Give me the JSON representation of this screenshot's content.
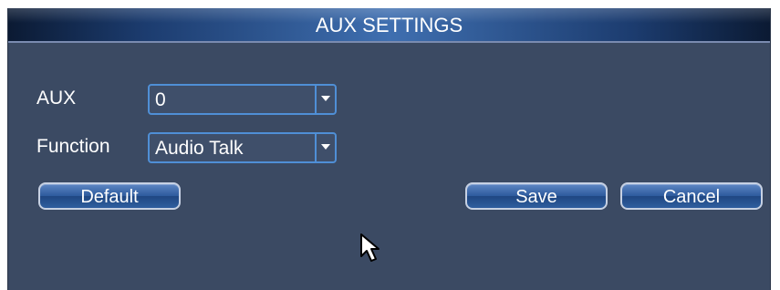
{
  "dialog": {
    "title": "AUX SETTINGS"
  },
  "fields": {
    "aux": {
      "label": "AUX",
      "value": "0"
    },
    "function": {
      "label": "Function",
      "value": "Audio Talk"
    }
  },
  "buttons": {
    "default_label": "Default",
    "save_label": "Save",
    "cancel_label": "Cancel"
  },
  "icons": {
    "dropdown_arrow": "chevron-down-icon",
    "cursor": "mouse-pointer-icon"
  },
  "colors": {
    "panel_bg": "#3b4a63",
    "accent_border": "#4f8fd6",
    "button_fill": "#2d5a9c"
  }
}
